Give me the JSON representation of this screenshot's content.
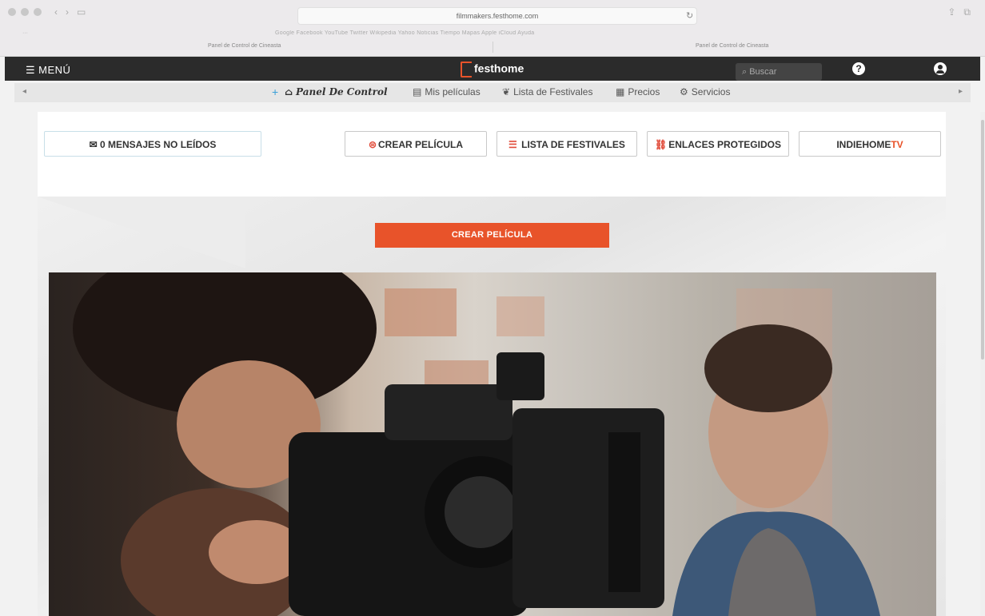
{
  "browser": {
    "url": "filmmakers.festhome.com",
    "favorites_left": "···",
    "favorites_center": "Google  Facebook  YouTube  Twitter  Wikipedia  Yahoo  Noticias  Tiempo  Mapas  Apple  iCloud  Ayuda",
    "tab_left": "Panel de Control de Cineasta",
    "tab_right": "Panel de Control de Cineasta"
  },
  "navbar": {
    "menu_label": "MENÚ",
    "logo_text": "festhome",
    "search_placeholder": "Buscar",
    "help_glyph": "?"
  },
  "subnav": {
    "tabs": [
      {
        "label": "Panel De Control",
        "icon": "home-icon"
      },
      {
        "label": "Mis películas",
        "icon": "film-icon"
      },
      {
        "label": "Lista de Festivales",
        "icon": "laurel-icon"
      },
      {
        "label": "Precios",
        "icon": "money-icon"
      },
      {
        "label": "Servicios",
        "icon": "gears-icon"
      }
    ]
  },
  "panel": {
    "messages_label": "0 MENSAJES NO LEÍDOS",
    "create_label": "CREAR PELÍCULA",
    "festivals_label": "LISTA DE FESTIVALES",
    "links_label": "ENLACES PROTEGIDOS",
    "tv_label_main": "INDIEHOME",
    "tv_label_accent": "TV"
  },
  "hero": {
    "cta_label": "CREAR PELÍCULA"
  },
  "colors": {
    "accent": "#e8532a",
    "navbar": "#2b2b2b",
    "link_blue": "#3aa0d8"
  }
}
